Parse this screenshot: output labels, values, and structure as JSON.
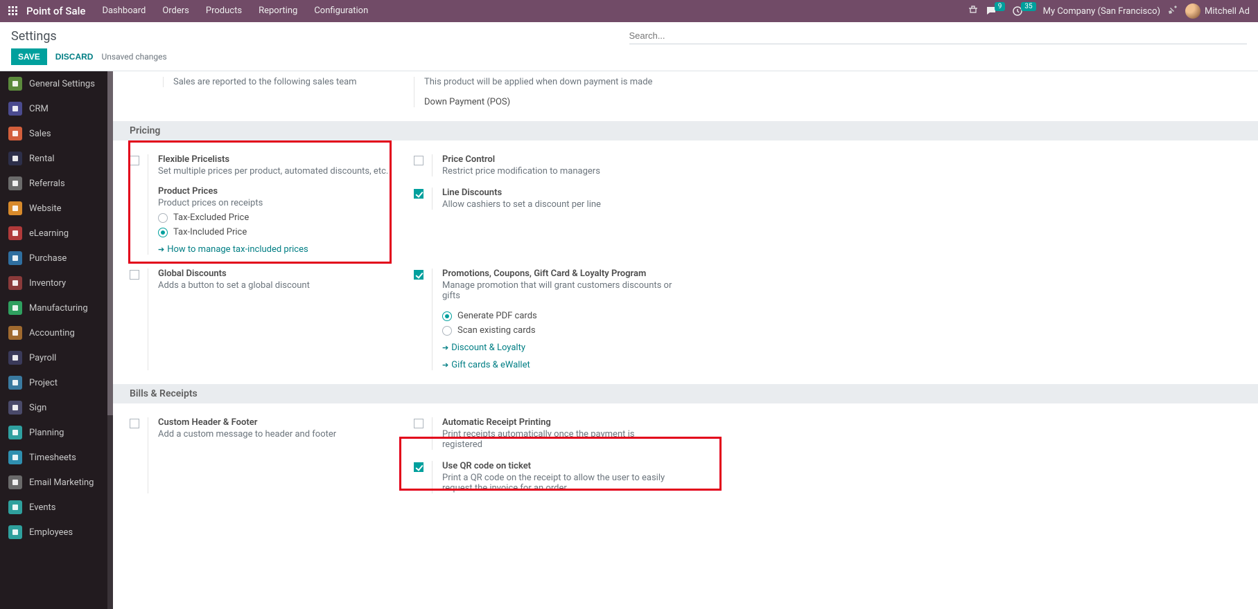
{
  "topbar": {
    "brand": "Point of Sale",
    "menu": [
      "Dashboard",
      "Orders",
      "Products",
      "Reporting",
      "Configuration"
    ],
    "chat_badge": "9",
    "activity_badge": "35",
    "company": "My Company (San Francisco)",
    "user": "Mitchell Ad"
  },
  "cp": {
    "title": "Settings",
    "search_placeholder": "Search...",
    "save": "SAVE",
    "discard": "DISCARD",
    "status": "Unsaved changes"
  },
  "sidebar": [
    {
      "label": "General Settings",
      "c": "#5b8a3c"
    },
    {
      "label": "CRM",
      "c": "#4b4b8f"
    },
    {
      "label": "Sales",
      "c": "#d35f3c"
    },
    {
      "label": "Rental",
      "c": "#2d2f4a"
    },
    {
      "label": "Referrals",
      "c": "#6b6b6b"
    },
    {
      "label": "Website",
      "c": "#d88a2b"
    },
    {
      "label": "eLearning",
      "c": "#b03a3a"
    },
    {
      "label": "Purchase",
      "c": "#2f6fa0"
    },
    {
      "label": "Inventory",
      "c": "#8a3a3a"
    },
    {
      "label": "Manufacturing",
      "c": "#2fa05f"
    },
    {
      "label": "Accounting",
      "c": "#a06a2f"
    },
    {
      "label": "Payroll",
      "c": "#3a3a5a"
    },
    {
      "label": "Project",
      "c": "#3a7aa0"
    },
    {
      "label": "Sign",
      "c": "#4a4a6a"
    },
    {
      "label": "Planning",
      "c": "#2fa0a0"
    },
    {
      "label": "Timesheets",
      "c": "#2f8faf"
    },
    {
      "label": "Email Marketing",
      "c": "#6a6a6a"
    },
    {
      "label": "Events",
      "c": "#2fa09d"
    },
    {
      "label": "Employees",
      "c": "#2fa09d"
    }
  ],
  "intro": {
    "left": "Sales are reported to the following sales team",
    "right": "This product will be applied when down payment is made",
    "right_val": "Down Payment (POS)"
  },
  "pricing_head": "Pricing",
  "bills_head": "Bills & Receipts",
  "settings": {
    "flex_pl": {
      "t": "Flexible Pricelists",
      "d": "Set multiple prices per product, automated discounts, etc."
    },
    "prod_prices": {
      "t": "Product Prices",
      "d": "Product prices on receipts"
    },
    "tax_excl": "Tax-Excluded Price",
    "tax_incl": "Tax-Included Price",
    "tax_link": "How to manage tax-included prices",
    "price_ctrl": {
      "t": "Price Control",
      "d": "Restrict price modification to managers"
    },
    "line_disc": {
      "t": "Line Discounts",
      "d": "Allow cashiers to set a discount per line"
    },
    "global_disc": {
      "t": "Global Discounts",
      "d": "Adds a button to set a global discount"
    },
    "promo": {
      "t": "Promotions, Coupons, Gift Card & Loyalty Program",
      "d": "Manage promotion that will grant customers discounts or gifts"
    },
    "gen_pdf": "Generate PDF cards",
    "scan_cards": "Scan existing cards",
    "disc_loyalty": "Discount & Loyalty",
    "gift_wallet": "Gift cards & eWallet",
    "custom_hf": {
      "t": "Custom Header & Footer",
      "d": "Add a custom message to header and footer"
    },
    "auto_print": {
      "t": "Automatic Receipt Printing",
      "d": "Print receipts automatically once the payment is registered"
    },
    "qr": {
      "t": "Use QR code on ticket",
      "d": "Print a QR code on the receipt to allow the user to easily request the invoice for an order."
    }
  }
}
